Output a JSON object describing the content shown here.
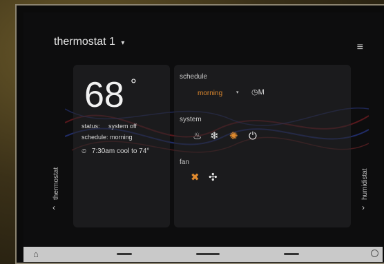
{
  "header": {
    "title": "thermostat 1",
    "title_caret": "▾",
    "menu_icon": "≡"
  },
  "thermostat": {
    "temperature": "68",
    "degree_symbol": "°",
    "status_label": "status:",
    "status_value": "system off",
    "schedule_label": "schedule:",
    "schedule_value": "morning",
    "next_event": "7:30am cool to 74°"
  },
  "schedule": {
    "label": "schedule",
    "value": "morning",
    "caret": "▾",
    "mode_label": "M"
  },
  "system": {
    "label": "system"
  },
  "fan": {
    "label": "fan"
  },
  "side_left": {
    "label": "thermostat",
    "chevron": "‹"
  },
  "side_right": {
    "label": "humidistat",
    "chevron": "›"
  },
  "colors": {
    "accent": "#e08a2e",
    "text": "#e8e8e8"
  }
}
